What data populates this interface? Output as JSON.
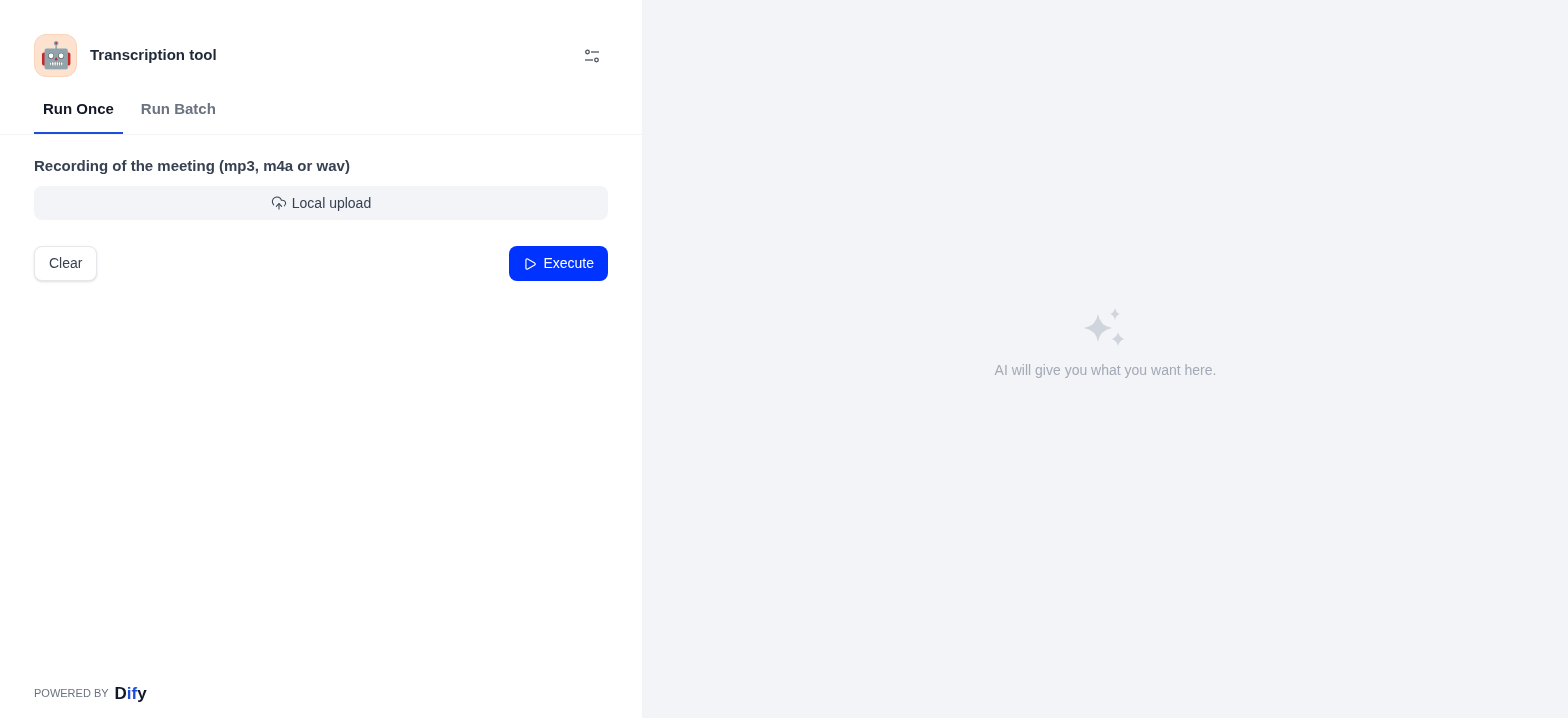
{
  "app": {
    "icon": "🤖",
    "title": "Transcription tool"
  },
  "tabs": [
    {
      "label": "Run Once",
      "selected": true
    },
    {
      "label": "Run Batch",
      "selected": false
    }
  ],
  "form": {
    "field_label": "Recording of the meeting (mp3, m4a or wav)",
    "upload_button": "Local upload",
    "clear_button": "Clear",
    "execute_button": "Execute"
  },
  "footer": {
    "powered_by": "POWERED BY",
    "logo": "Dify"
  },
  "result": {
    "empty_text": "AI will give you what you want here."
  }
}
